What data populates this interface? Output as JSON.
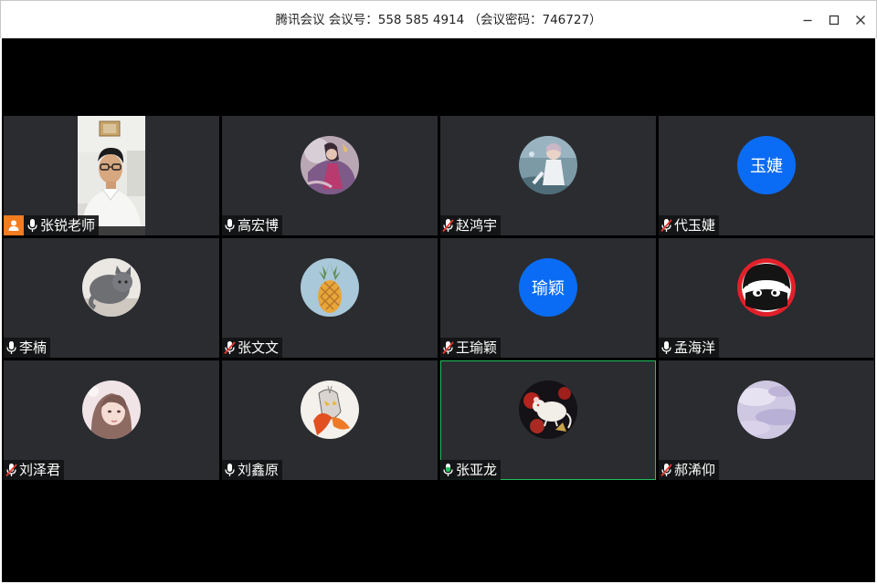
{
  "window": {
    "title": "腾讯会议 会议号：558 585 4914 （会议密码：746727）",
    "minimize_icon": "minimize-icon",
    "maximize_icon": "maximize-icon",
    "close_icon": "close-icon"
  },
  "colors": {
    "stage_background": "#000000",
    "tile_background": "#2a2c30",
    "text_avatar": "#0a6cf5",
    "active_speaker_border": "#21c05b",
    "host_badge": "#f57c1f",
    "mic_muted_slash": "#e8372f"
  },
  "participants": [
    {
      "name": "张锐老师",
      "mic": "on",
      "host": true,
      "avatar": "camera-video",
      "active": false
    },
    {
      "name": "高宏博",
      "mic": "on",
      "host": false,
      "avatar": "image",
      "active": false
    },
    {
      "name": "赵鸿宇",
      "mic": "muted",
      "host": false,
      "avatar": "image",
      "active": false
    },
    {
      "name": "代玉婕",
      "mic": "muted",
      "host": false,
      "avatar": "text",
      "avatar_text": "玉婕",
      "active": false
    },
    {
      "name": "李楠",
      "mic": "on",
      "host": false,
      "avatar": "image",
      "active": false
    },
    {
      "name": "张文文",
      "mic": "muted",
      "host": false,
      "avatar": "image",
      "active": false
    },
    {
      "name": "王瑜颖",
      "mic": "muted",
      "host": false,
      "avatar": "text",
      "avatar_text": "瑜颖",
      "active": false
    },
    {
      "name": "孟海洋",
      "mic": "on",
      "host": false,
      "avatar": "image",
      "active": false
    },
    {
      "name": "刘泽君",
      "mic": "muted",
      "host": false,
      "avatar": "image",
      "active": false
    },
    {
      "name": "刘鑫原",
      "mic": "on",
      "host": false,
      "avatar": "image",
      "active": false
    },
    {
      "name": "张亚龙",
      "mic": "speaking",
      "host": false,
      "avatar": "image",
      "active": true
    },
    {
      "name": "郝浠仰",
      "mic": "muted",
      "host": false,
      "avatar": "image",
      "active": false
    }
  ]
}
